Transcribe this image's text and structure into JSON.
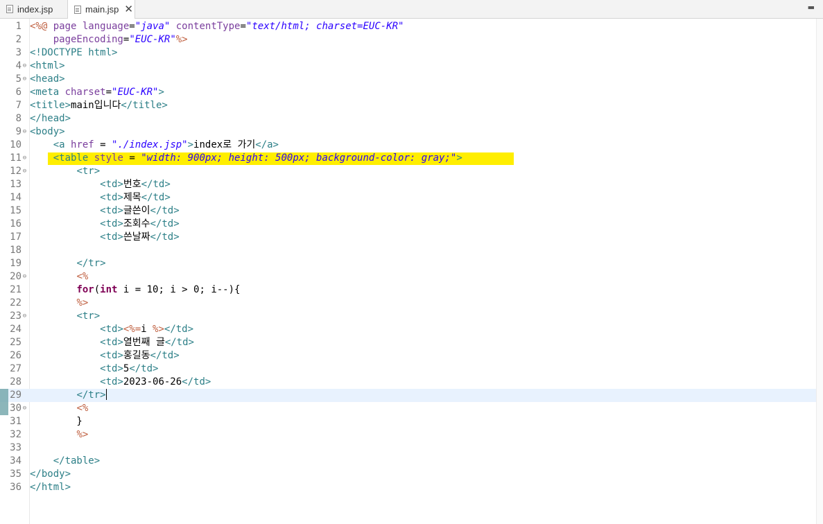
{
  "tabs": [
    {
      "label": "index.jsp",
      "active": false
    },
    {
      "label": "main.jsp",
      "active": true
    }
  ],
  "window_button": "▬",
  "current_line": 29,
  "highlighted_line": 11,
  "colors": {
    "highlight": "#ffee00",
    "current_line": "#e8f2fe",
    "tag": "#2c7f87",
    "attr_value": "#2a00ff",
    "keyword": "#7f0055",
    "jsp": "#bf5f3f"
  },
  "lines": [
    {
      "n": "1",
      "fold": false,
      "t": [
        [
          "jsp",
          "<%@ "
        ],
        [
          "atn",
          "page language"
        ],
        [
          "tx",
          "="
        ],
        [
          "av",
          "\"java\""
        ],
        [
          "tx",
          " "
        ],
        [
          "atn",
          "contentType"
        ],
        [
          "tx",
          "="
        ],
        [
          "av",
          "\"text/html; charset=EUC-KR\""
        ]
      ]
    },
    {
      "n": "2",
      "fold": false,
      "t": [
        [
          "tx",
          "    "
        ],
        [
          "atn",
          "pageEncoding"
        ],
        [
          "tx",
          "="
        ],
        [
          "av",
          "\"EUC-KR\""
        ],
        [
          "jsp",
          "%>"
        ]
      ]
    },
    {
      "n": "3",
      "fold": false,
      "t": [
        [
          "dt",
          "<!DOCTYPE html>"
        ]
      ]
    },
    {
      "n": "4",
      "fold": true,
      "t": [
        [
          "tag",
          "<html>"
        ]
      ]
    },
    {
      "n": "5",
      "fold": true,
      "t": [
        [
          "tag",
          "<head>"
        ]
      ]
    },
    {
      "n": "6",
      "fold": false,
      "t": [
        [
          "tag",
          "<meta "
        ],
        [
          "atn",
          "charset"
        ],
        [
          "tx",
          "="
        ],
        [
          "av",
          "\"EUC-KR\""
        ],
        [
          "tag",
          ">"
        ]
      ]
    },
    {
      "n": "7",
      "fold": false,
      "t": [
        [
          "tag",
          "<title>"
        ],
        [
          "tx",
          "main입니다"
        ],
        [
          "tag",
          "</title>"
        ]
      ]
    },
    {
      "n": "8",
      "fold": false,
      "t": [
        [
          "tag",
          "</head>"
        ]
      ]
    },
    {
      "n": "9",
      "fold": true,
      "t": [
        [
          "tag",
          "<body>"
        ]
      ]
    },
    {
      "n": "10",
      "fold": false,
      "t": [
        [
          "tx",
          "    "
        ],
        [
          "tag",
          "<a "
        ],
        [
          "atn",
          "href"
        ],
        [
          "tx",
          " = "
        ],
        [
          "av",
          "\"./index.jsp\""
        ],
        [
          "tag",
          ">"
        ],
        [
          "tx",
          "index로 가기"
        ],
        [
          "tag",
          "</a>"
        ]
      ]
    },
    {
      "n": "11",
      "fold": true,
      "t": [
        [
          "tx",
          "    "
        ],
        [
          "tag",
          "<table "
        ],
        [
          "atn",
          "style"
        ],
        [
          "tx",
          " = "
        ],
        [
          "av",
          "\"width: 900px; height: 500px; background-color: gray;\""
        ],
        [
          "tag",
          ">"
        ]
      ]
    },
    {
      "n": "12",
      "fold": true,
      "t": [
        [
          "tx",
          "        "
        ],
        [
          "tag",
          "<tr>"
        ]
      ]
    },
    {
      "n": "13",
      "fold": false,
      "t": [
        [
          "tx",
          "            "
        ],
        [
          "tag",
          "<td>"
        ],
        [
          "tx",
          "번호"
        ],
        [
          "tag",
          "</td>"
        ]
      ]
    },
    {
      "n": "14",
      "fold": false,
      "t": [
        [
          "tx",
          "            "
        ],
        [
          "tag",
          "<td>"
        ],
        [
          "tx",
          "제목"
        ],
        [
          "tag",
          "</td>"
        ]
      ]
    },
    {
      "n": "15",
      "fold": false,
      "t": [
        [
          "tx",
          "            "
        ],
        [
          "tag",
          "<td>"
        ],
        [
          "tx",
          "글쓴이"
        ],
        [
          "tag",
          "</td>"
        ]
      ]
    },
    {
      "n": "16",
      "fold": false,
      "t": [
        [
          "tx",
          "            "
        ],
        [
          "tag",
          "<td>"
        ],
        [
          "tx",
          "조회수"
        ],
        [
          "tag",
          "</td>"
        ]
      ]
    },
    {
      "n": "17",
      "fold": false,
      "t": [
        [
          "tx",
          "            "
        ],
        [
          "tag",
          "<td>"
        ],
        [
          "tx",
          "쓴날짜"
        ],
        [
          "tag",
          "</td>"
        ]
      ]
    },
    {
      "n": "18",
      "fold": false,
      "t": []
    },
    {
      "n": "19",
      "fold": false,
      "t": [
        [
          "tx",
          "        "
        ],
        [
          "tag",
          "</tr>"
        ]
      ]
    },
    {
      "n": "20",
      "fold": true,
      "t": [
        [
          "tx",
          "        "
        ],
        [
          "jsp",
          "<%"
        ]
      ]
    },
    {
      "n": "21",
      "fold": false,
      "t": [
        [
          "tx",
          "        "
        ],
        [
          "kw",
          "for"
        ],
        [
          "tx",
          "("
        ],
        [
          "kw",
          "int"
        ],
        [
          "tx",
          " i = 10; i > 0; i--){"
        ]
      ]
    },
    {
      "n": "22",
      "fold": false,
      "t": [
        [
          "tx",
          "        "
        ],
        [
          "jsp",
          "%>"
        ]
      ]
    },
    {
      "n": "23",
      "fold": true,
      "t": [
        [
          "tx",
          "        "
        ],
        [
          "tag",
          "<tr>"
        ]
      ]
    },
    {
      "n": "24",
      "fold": false,
      "t": [
        [
          "tx",
          "            "
        ],
        [
          "tag",
          "<td>"
        ],
        [
          "jsp",
          "<%="
        ],
        [
          "tx",
          "i "
        ],
        [
          "jsp",
          "%>"
        ],
        [
          "tag",
          "</td>"
        ]
      ]
    },
    {
      "n": "25",
      "fold": false,
      "t": [
        [
          "tx",
          "            "
        ],
        [
          "tag",
          "<td>"
        ],
        [
          "tx",
          "열번째 글"
        ],
        [
          "tag",
          "</td>"
        ]
      ]
    },
    {
      "n": "26",
      "fold": false,
      "t": [
        [
          "tx",
          "            "
        ],
        [
          "tag",
          "<td>"
        ],
        [
          "tx",
          "홍길동"
        ],
        [
          "tag",
          "</td>"
        ]
      ]
    },
    {
      "n": "27",
      "fold": false,
      "t": [
        [
          "tx",
          "            "
        ],
        [
          "tag",
          "<td>"
        ],
        [
          "tx",
          "5"
        ],
        [
          "tag",
          "</td>"
        ]
      ]
    },
    {
      "n": "28",
      "fold": false,
      "t": [
        [
          "tx",
          "            "
        ],
        [
          "tag",
          "<td>"
        ],
        [
          "tx",
          "2023-06-26"
        ],
        [
          "tag",
          "</td>"
        ]
      ]
    },
    {
      "n": "29",
      "fold": false,
      "t": [
        [
          "tx",
          "        "
        ],
        [
          "tag",
          "</tr>"
        ]
      ]
    },
    {
      "n": "30",
      "fold": true,
      "t": [
        [
          "tx",
          "        "
        ],
        [
          "jsp",
          "<%"
        ]
      ]
    },
    {
      "n": "31",
      "fold": false,
      "t": [
        [
          "tx",
          "        }"
        ]
      ]
    },
    {
      "n": "32",
      "fold": false,
      "t": [
        [
          "tx",
          "        "
        ],
        [
          "jsp",
          "%>"
        ]
      ]
    },
    {
      "n": "33",
      "fold": false,
      "t": []
    },
    {
      "n": "34",
      "fold": false,
      "t": [
        [
          "tx",
          "    "
        ],
        [
          "tag",
          "</table>"
        ]
      ]
    },
    {
      "n": "35",
      "fold": false,
      "t": [
        [
          "tag",
          "</body>"
        ]
      ]
    },
    {
      "n": "36",
      "fold": false,
      "t": [
        [
          "tag",
          "</html>"
        ]
      ]
    }
  ]
}
